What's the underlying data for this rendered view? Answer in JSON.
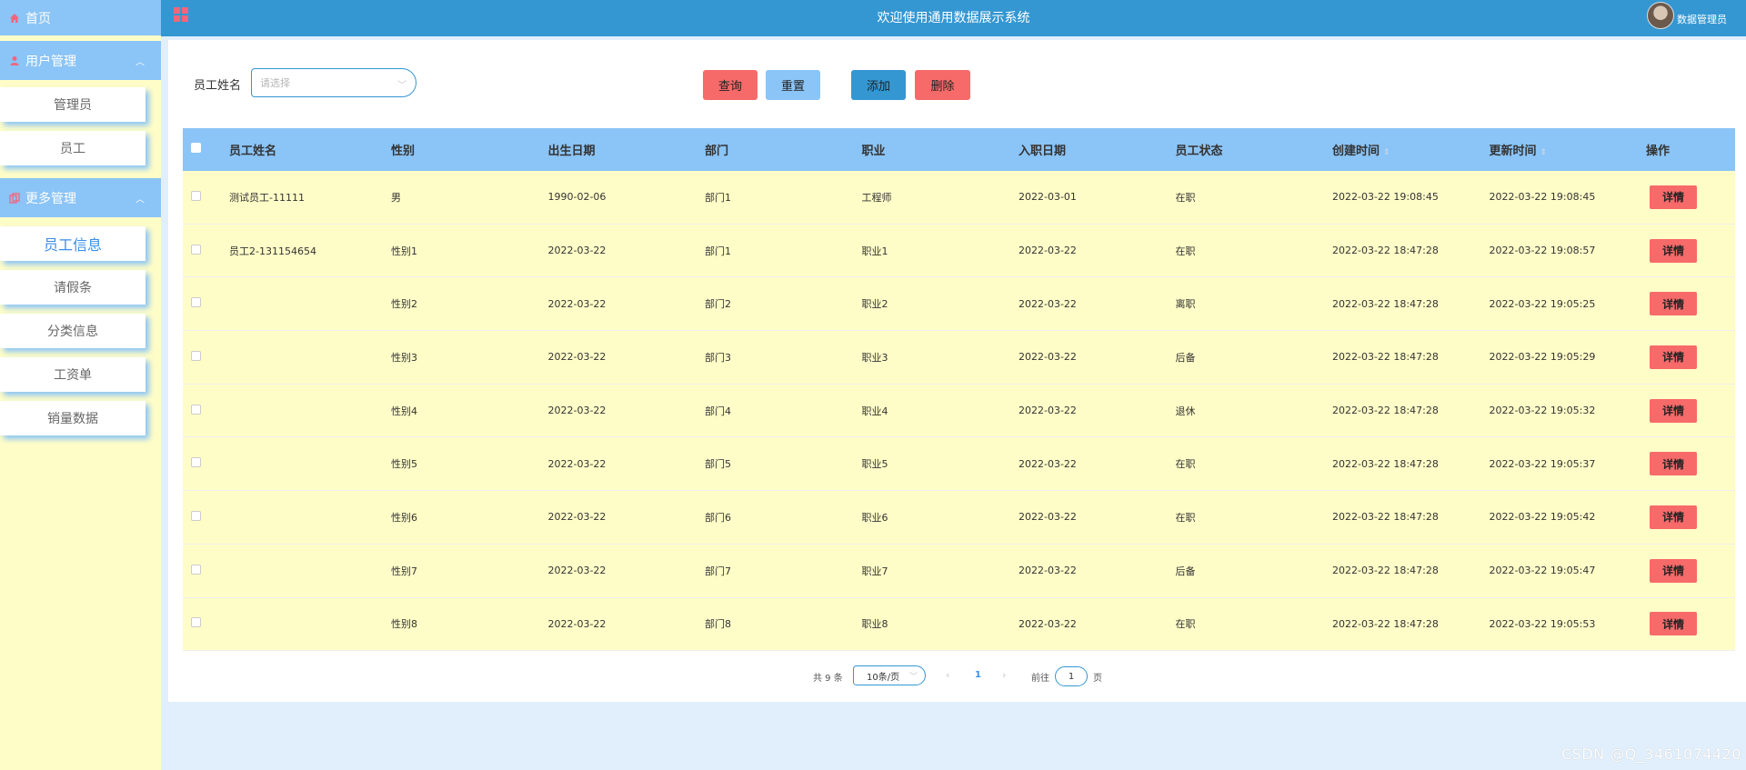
{
  "app": {
    "title": "欢迎使用通用数据展示系统",
    "user_label": "数据管理员"
  },
  "sidebar": {
    "home": "首页",
    "groups": [
      {
        "label": "用户管理",
        "items": [
          "管理员",
          "员工"
        ]
      },
      {
        "label": "更多管理",
        "items": [
          "员工信息",
          "请假条",
          "分类信息",
          "工资单",
          "销量数据"
        ],
        "active": "员工信息"
      }
    ]
  },
  "search": {
    "label": "员工姓名",
    "placeholder": "请选择"
  },
  "buttons": {
    "query": "查询",
    "reset": "重置",
    "add": "添加",
    "delete": "删除",
    "detail": "详情"
  },
  "table": {
    "headers": [
      "员工姓名",
      "性别",
      "出生日期",
      "部门",
      "职业",
      "入职日期",
      "员工状态",
      "创建时间",
      "更新时间",
      "操作"
    ],
    "rows": [
      [
        "测试员工-11111",
        "男",
        "1990-02-06",
        "部门1",
        "工程师",
        "2022-03-01",
        "在职",
        "2022-03-22 19:08:45",
        "2022-03-22 19:08:45"
      ],
      [
        "员工2-131154654",
        "性别1",
        "2022-03-22",
        "部门1",
        "职业1",
        "2022-03-22",
        "在职",
        "2022-03-22 18:47:28",
        "2022-03-22 19:08:57"
      ],
      [
        "",
        "性别2",
        "2022-03-22",
        "部门2",
        "职业2",
        "2022-03-22",
        "离职",
        "2022-03-22 18:47:28",
        "2022-03-22 19:05:25"
      ],
      [
        "",
        "性别3",
        "2022-03-22",
        "部门3",
        "职业3",
        "2022-03-22",
        "后备",
        "2022-03-22 18:47:28",
        "2022-03-22 19:05:29"
      ],
      [
        "",
        "性别4",
        "2022-03-22",
        "部门4",
        "职业4",
        "2022-03-22",
        "退休",
        "2022-03-22 18:47:28",
        "2022-03-22 19:05:32"
      ],
      [
        "",
        "性别5",
        "2022-03-22",
        "部门5",
        "职业5",
        "2022-03-22",
        "在职",
        "2022-03-22 18:47:28",
        "2022-03-22 19:05:37"
      ],
      [
        "",
        "性别6",
        "2022-03-22",
        "部门6",
        "职业6",
        "2022-03-22",
        "在职",
        "2022-03-22 18:47:28",
        "2022-03-22 19:05:42"
      ],
      [
        "",
        "性别7",
        "2022-03-22",
        "部门7",
        "职业7",
        "2022-03-22",
        "后备",
        "2022-03-22 18:47:28",
        "2022-03-22 19:05:47"
      ],
      [
        "",
        "性别8",
        "2022-03-22",
        "部门8",
        "职业8",
        "2022-03-22",
        "在职",
        "2022-03-22 18:47:28",
        "2022-03-22 19:05:53"
      ]
    ]
  },
  "pagination": {
    "total": "共 9 条",
    "page_size": "10条/页",
    "current_page": "1",
    "goto_label": "前往",
    "goto_value": "1",
    "page_suffix": "页"
  },
  "watermark": "CSDN @Q_3461074420",
  "colors": {
    "header_blue": "#3497d2",
    "light_blue": "#8bc4f6",
    "cream": "#fffdc7",
    "red": "#f76a6a"
  },
  "icons": [
    "home-icon",
    "user-icon",
    "more-icon",
    "grid-menu-icon",
    "chevron-up-icon",
    "chevron-down-icon",
    "sort-icon"
  ]
}
